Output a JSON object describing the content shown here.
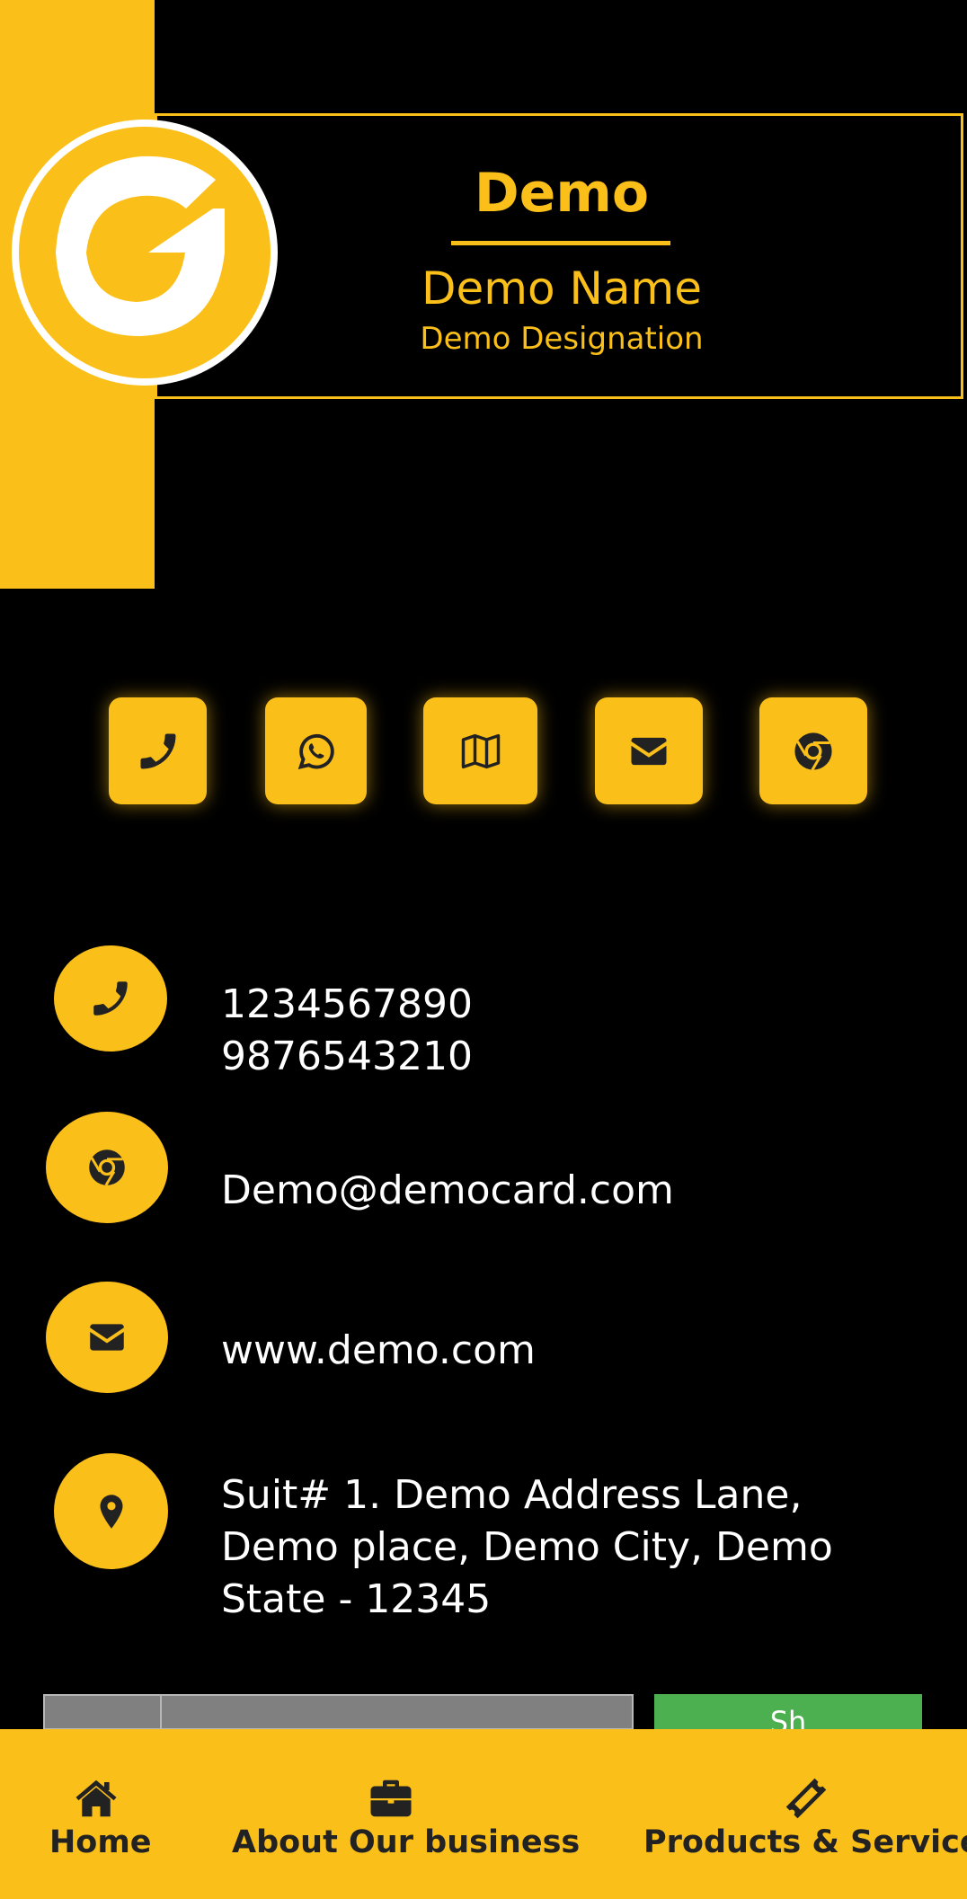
{
  "header": {
    "company": "Demo",
    "name": "Demo Name",
    "designation": "Demo Designation"
  },
  "quick_actions": [
    {
      "icon": "phone-icon"
    },
    {
      "icon": "whatsapp-icon"
    },
    {
      "icon": "map-icon"
    },
    {
      "icon": "envelope-icon"
    },
    {
      "icon": "chrome-icon"
    }
  ],
  "contact": {
    "phone1": "1234567890",
    "phone2": "9876543210",
    "email": "Demo@democard.com",
    "website": "www.demo.com",
    "address_line1": "Suit# 1. Demo Address Lane,",
    "address_line2": "Demo place, Demo City, Demo",
    "address_line3": "State - 12345"
  },
  "share": {
    "label": "Sh"
  },
  "nav": {
    "home": "Home",
    "about": "About Our business",
    "products": "Products & Services"
  },
  "colors": {
    "accent": "#fbbf1a",
    "background": "#000000",
    "text": "#ffffff",
    "share_button": "#4caf50",
    "nav_text": "#222222"
  }
}
